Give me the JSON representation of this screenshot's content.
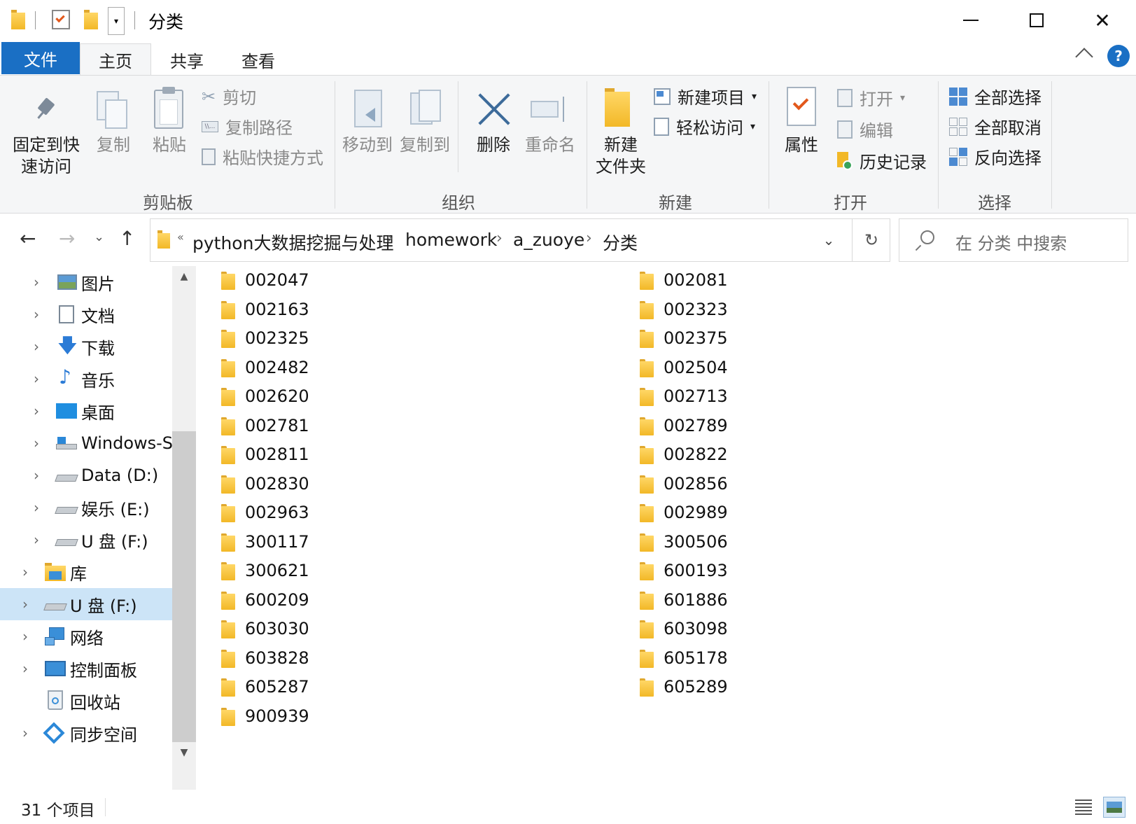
{
  "window": {
    "title": "分类",
    "minimize": "—",
    "maximize": "☐",
    "close": "✕"
  },
  "tabs": {
    "file": "文件",
    "home": "主页",
    "share": "共享",
    "view": "查看",
    "help": "?"
  },
  "ribbon": {
    "clipboard": {
      "pin": "固定到快\n速访问",
      "pin_l1": "固定到快",
      "pin_l2": "速访问",
      "copy": "复制",
      "paste": "粘贴",
      "cut": "剪切",
      "copy_path": "复制路径",
      "paste_shortcut": "粘贴快捷方式",
      "label": "剪贴板"
    },
    "organize": {
      "move_to": "移动到",
      "copy_to": "复制到",
      "delete": "删除",
      "rename": "重命名",
      "label": "组织"
    },
    "new": {
      "new_folder_l1": "新建",
      "new_folder_l2": "文件夹",
      "new_item": "新建项目",
      "easy_access": "轻松访问",
      "label": "新建"
    },
    "open": {
      "properties": "属性",
      "open": "打开",
      "edit": "编辑",
      "history": "历史记录",
      "label": "打开"
    },
    "select": {
      "select_all": "全部选择",
      "select_none": "全部取消",
      "invert": "反向选择",
      "label": "选择"
    }
  },
  "address": {
    "overflow": "«",
    "crumbs": [
      "python大数据挖掘与处理",
      "homework",
      "a_zuoye",
      "分类"
    ],
    "search_placeholder": "在 分类 中搜索"
  },
  "sidebar": {
    "items": [
      {
        "label": "图片",
        "icon": "pictures-icon"
      },
      {
        "label": "文档",
        "icon": "documents-icon"
      },
      {
        "label": "下载",
        "icon": "downloads-icon"
      },
      {
        "label": "音乐",
        "icon": "music-icon"
      },
      {
        "label": "桌面",
        "icon": "desktop-icon"
      },
      {
        "label": "Windows-S",
        "icon": "windows-drive-icon"
      },
      {
        "label": "Data (D:)",
        "icon": "drive-icon"
      },
      {
        "label": "娱乐 (E:)",
        "icon": "drive-icon"
      },
      {
        "label": "U 盘 (F:)",
        "icon": "usb-drive-icon"
      },
      {
        "label": "库",
        "icon": "library-icon"
      },
      {
        "label": "U 盘 (F:)",
        "icon": "usb-drive-icon"
      },
      {
        "label": "网络",
        "icon": "network-icon"
      },
      {
        "label": "控制面板",
        "icon": "control-panel-icon"
      },
      {
        "label": "回收站",
        "icon": "recycle-bin-icon"
      },
      {
        "label": "同步空间",
        "icon": "sync-space-icon"
      }
    ]
  },
  "files": {
    "left": [
      "002047",
      "002163",
      "002325",
      "002482",
      "002620",
      "002781",
      "002811",
      "002830",
      "002963",
      "300117",
      "300621",
      "600209",
      "603030",
      "603828",
      "605287",
      "900939"
    ],
    "right": [
      "002081",
      "002323",
      "002375",
      "002504",
      "002713",
      "002789",
      "002822",
      "002856",
      "002989",
      "300506",
      "600193",
      "601886",
      "603098",
      "605178",
      "605289"
    ]
  },
  "status": {
    "count": "31 个项目"
  },
  "colors": {
    "file_tab": "#1a6fc4",
    "selected_nav": "#cce4f7",
    "folder": "#f2b827"
  }
}
